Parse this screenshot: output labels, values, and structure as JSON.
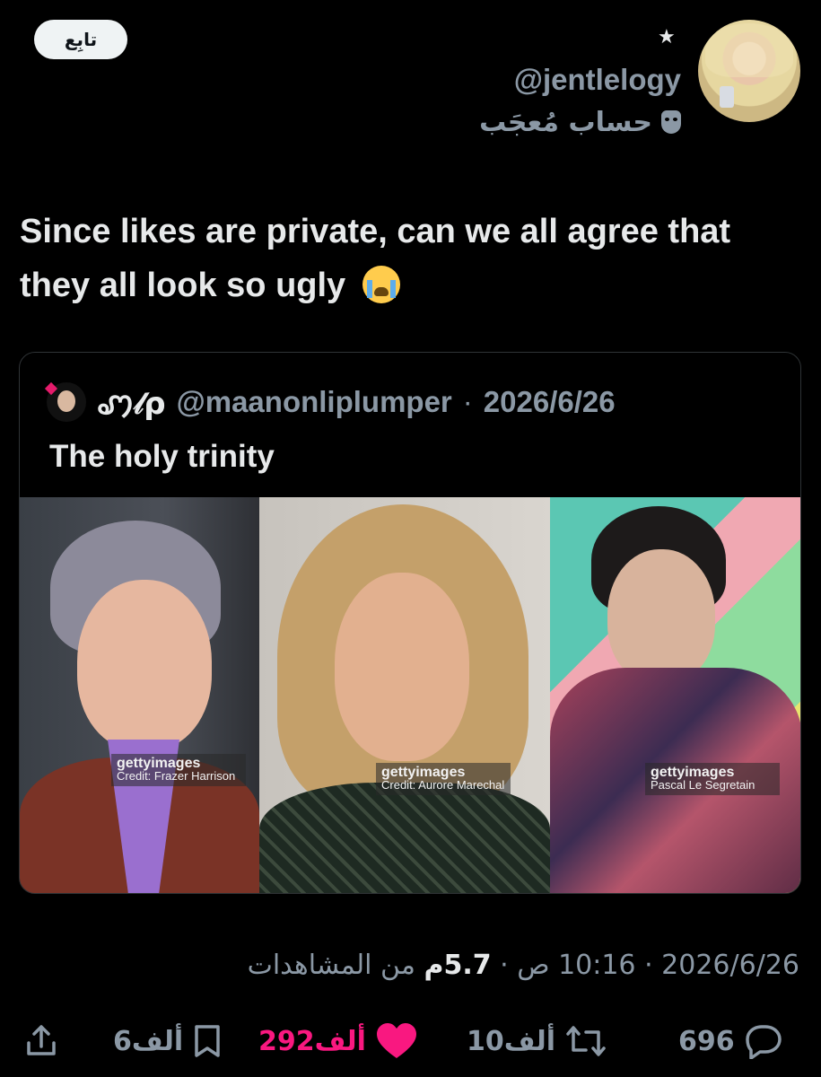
{
  "author": {
    "follow_label": "تابِع",
    "handle": "@jentlelogy",
    "account_label": "حساب مُعجَب"
  },
  "tweet": {
    "text": "Since likes are private, can we all agree that they all look so ugly"
  },
  "quote": {
    "name": "ꩇ𝓁ρ",
    "handle": "@maanonliplumper",
    "separator": "·",
    "date": "2026/6/26",
    "text": "The holy trinity",
    "photos": [
      {
        "watermark": "gettyimages",
        "credit": "Credit: Frazer Harrison"
      },
      {
        "watermark": "gettyimages",
        "credit": "Credit: Aurore Marechal"
      },
      {
        "watermark": "gettyimages",
        "credit": "Pascal Le Segretain"
      }
    ]
  },
  "meta": {
    "date": "2026/6/26",
    "sep1": "·",
    "time": "10:16 ص",
    "sep2": "·",
    "views_value": "5.7م",
    "views_label": "من المشاهدات"
  },
  "actions": {
    "replies": "696",
    "retweets": "10ألف",
    "likes": "292ألف",
    "bookmarks": "6ألف"
  },
  "colors": {
    "background": "#000000",
    "like_pink": "#f91880",
    "muted": "#8b98a5"
  },
  "icons": [
    "star-icon",
    "mask-icon",
    "reply-icon",
    "retweet-icon",
    "heart-icon",
    "bookmark-icon",
    "share-icon",
    "crying-face-emoji"
  ]
}
